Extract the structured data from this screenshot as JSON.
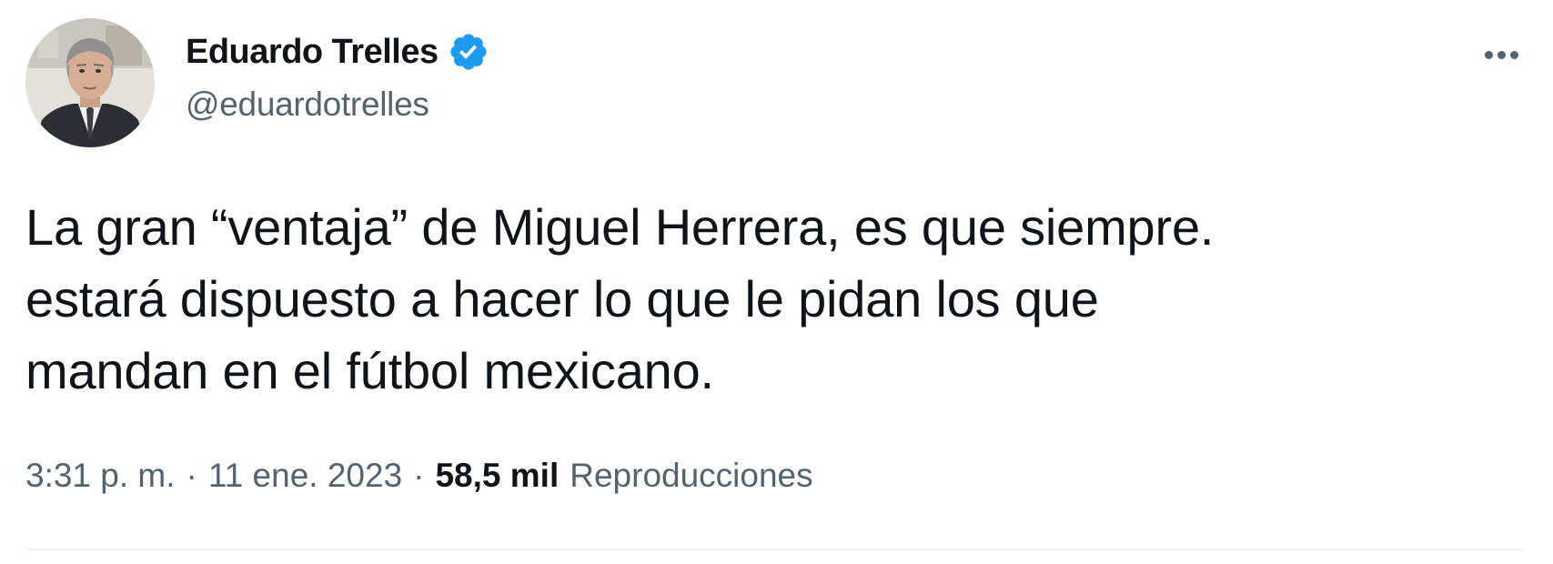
{
  "author": {
    "display_name": "Eduardo Trelles",
    "handle": "@eduardotrelles",
    "verified": true,
    "avatar_icon": "profile-photo"
  },
  "tweet": {
    "text_lines": [
      "La gran “ventaja” de Miguel Herrera, es que siempre.",
      "estará dispuesto a hacer lo que le pidan los que",
      "mandan en el fútbol mexicano."
    ],
    "time": "3:31 p. m.",
    "separator": "·",
    "date": "11 ene. 2023",
    "views_count": "58,5 mil",
    "views_label": "Reproducciones"
  },
  "more_icon": "more-options-icon",
  "colors": {
    "text_primary": "#0f1419",
    "text_secondary": "#536471",
    "verified_blue": "#1d9bf0",
    "divider": "#eff3f4"
  }
}
